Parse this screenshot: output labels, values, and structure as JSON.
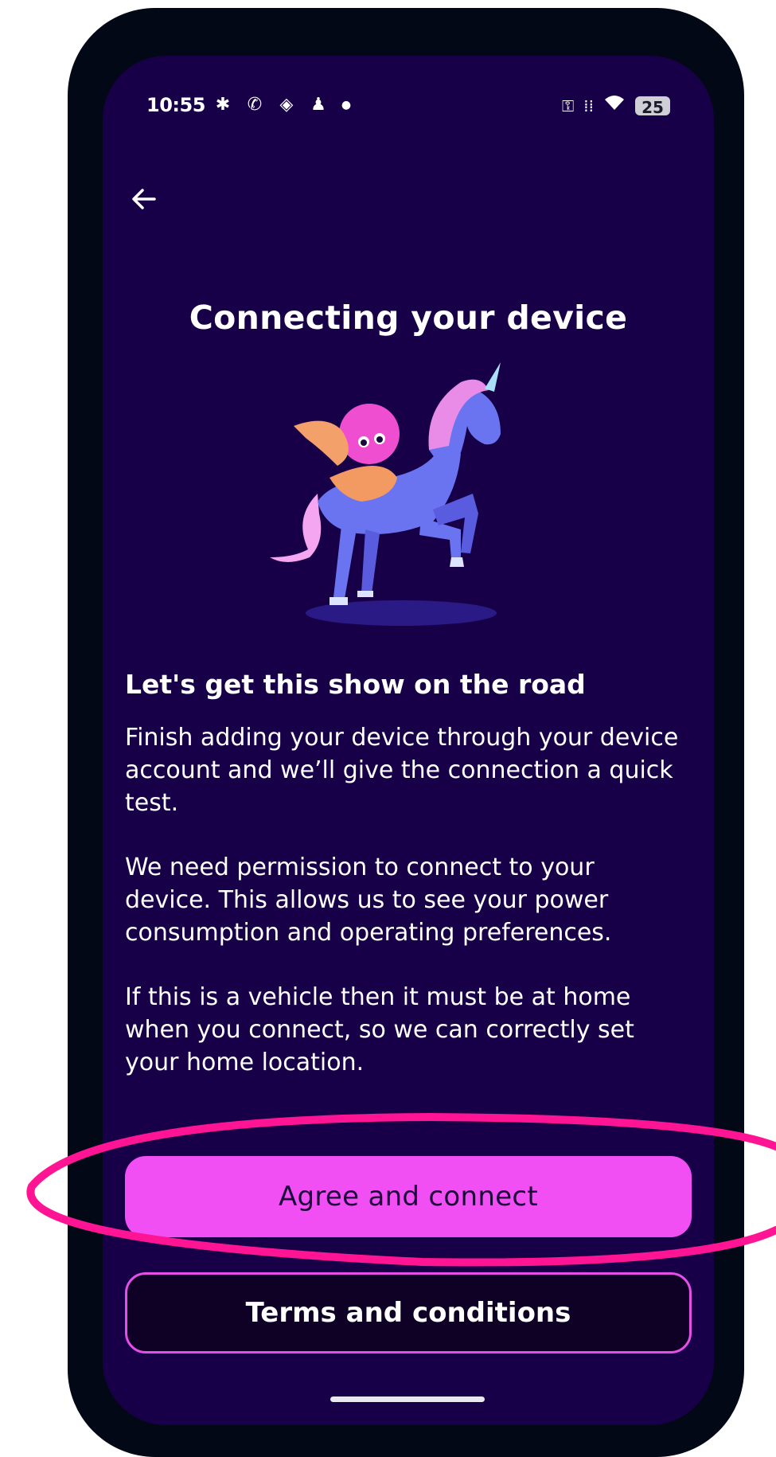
{
  "status_bar": {
    "time": "10:55",
    "battery_level": "25",
    "notification_icons": [
      "slack-icon",
      "whatsapp-icon",
      "stack-icon",
      "teams-icon"
    ],
    "system_icons": [
      "vpn-key-icon",
      "signal-icon",
      "wifi-icon",
      "battery-icon"
    ]
  },
  "header": {
    "back_icon": "arrow-left-icon",
    "title": "Connecting your device"
  },
  "illustration": {
    "icon": "unicorn-octopus-illustration"
  },
  "content": {
    "headline": "Let's get this show on the road",
    "paragraph_1": "Finish adding your device through your device account and we’ll give the connection a quick test.",
    "paragraph_2": "We need permission to connect to your device. This allows us to see your power consumption and operating preferences.",
    "paragraph_3": "If this is a vehicle then it must be at home when you connect, so we can correctly set your home location."
  },
  "actions": {
    "primary_label": "Agree and connect",
    "secondary_label": "Terms and conditions"
  },
  "colors": {
    "screen_background": "#180048",
    "primary_button": "#f14ef4",
    "secondary_border": "#e64ee8",
    "highlight_annotation": "#ff1493"
  }
}
